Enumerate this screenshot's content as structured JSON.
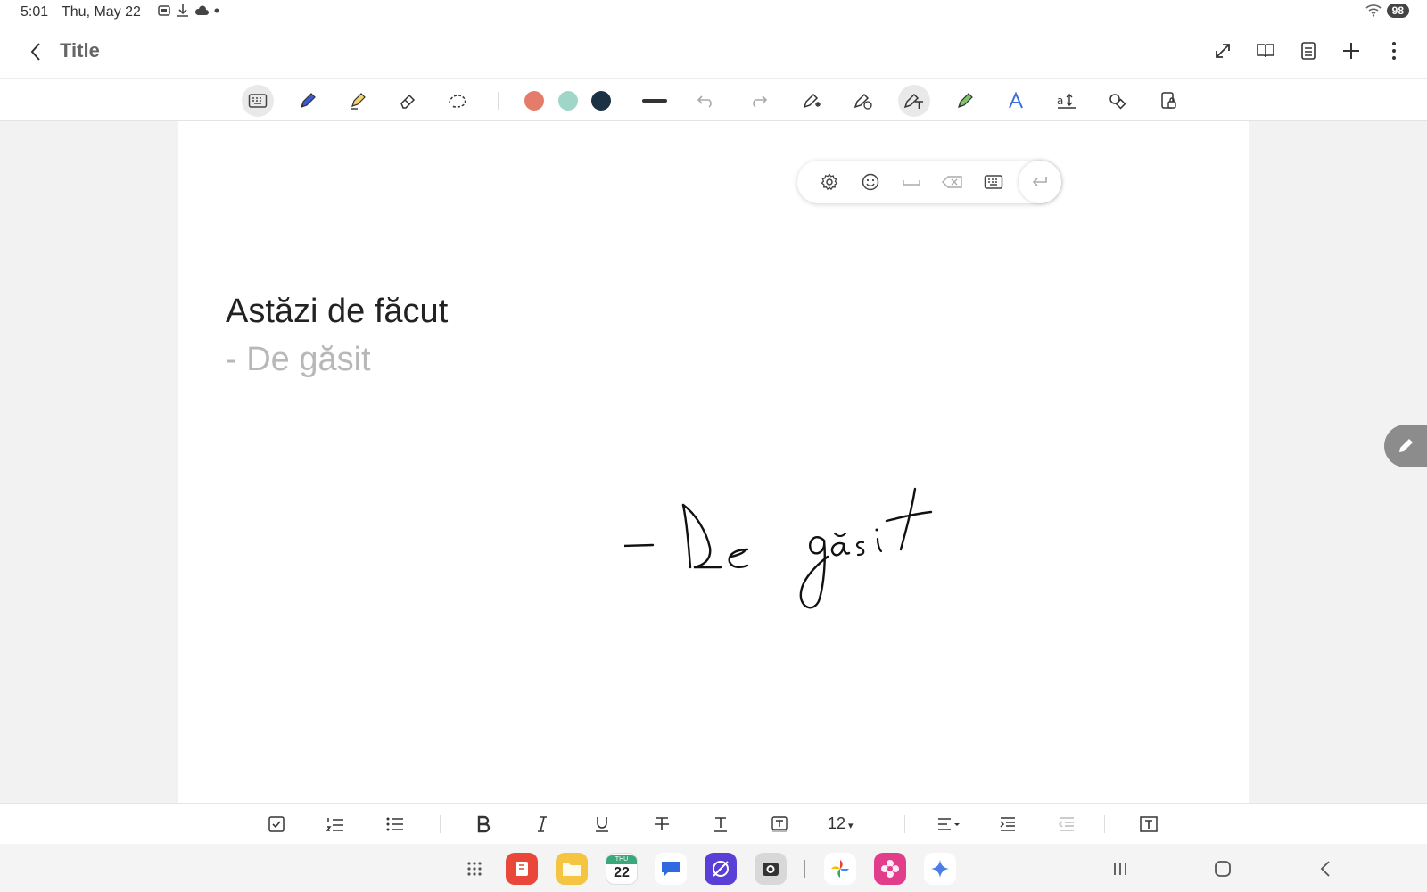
{
  "status_bar": {
    "time": "5:01",
    "date": "Thu, May 22",
    "battery": "98"
  },
  "header": {
    "title": "Title"
  },
  "toolbar": {
    "icons": [
      "keyboard-icon",
      "pen-icon",
      "highlighter-icon",
      "eraser-icon",
      "lasso-icon",
      "shape-pen-icon",
      "handwriting-to-text-icon",
      "text-pen-icon",
      "green-pen-icon",
      "text-style-icon",
      "text-size-icon",
      "shapes-icon",
      "lock-page-icon"
    ],
    "colors": {
      "red": "#e57b6a",
      "teal": "#9fd6c8",
      "navy": "#1d3144"
    }
  },
  "note": {
    "heading": "Astăzi de făcut",
    "ghost_line": "- De găsit",
    "handwriting": "- De găsit"
  },
  "format_bar": {
    "font_size": "12"
  },
  "taskbar": {
    "calendar_day_label": "THU",
    "calendar_day_number": "22"
  }
}
